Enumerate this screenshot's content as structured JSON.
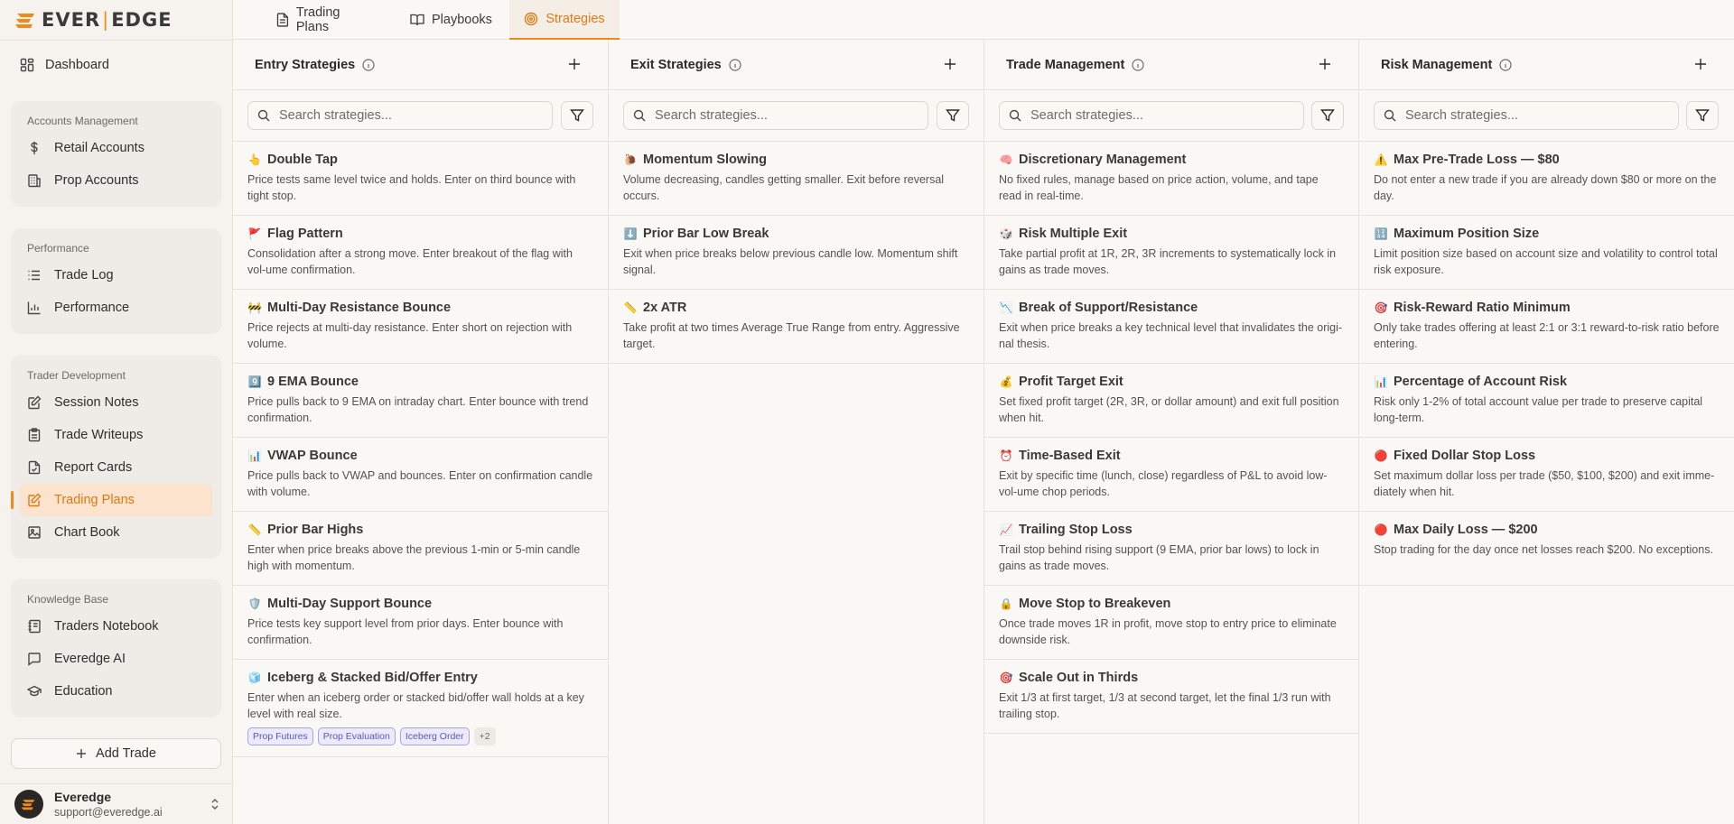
{
  "brand": {
    "left": "EVER",
    "sep": "|",
    "right": "EDGE",
    "accent": "#f28a1a"
  },
  "sidebar": {
    "dashboard": "Dashboard",
    "groups": [
      {
        "title": "Accounts Management",
        "items": [
          {
            "label": "Retail Accounts",
            "icon": "dollar-icon"
          },
          {
            "label": "Prop Accounts",
            "icon": "building-icon"
          }
        ]
      },
      {
        "title": "Performance",
        "items": [
          {
            "label": "Trade Log",
            "icon": "list-icon"
          },
          {
            "label": "Performance",
            "icon": "bar-chart-icon"
          }
        ]
      },
      {
        "title": "Trader Development",
        "items": [
          {
            "label": "Session Notes",
            "icon": "edit-note-icon"
          },
          {
            "label": "Trade Writeups",
            "icon": "clipboard-icon"
          },
          {
            "label": "Report Cards",
            "icon": "file-check-icon"
          },
          {
            "label": "Trading Plans",
            "icon": "pencil-square-icon",
            "active": true
          },
          {
            "label": "Chart Book",
            "icon": "image-icon"
          }
        ]
      },
      {
        "title": "Knowledge Base",
        "items": [
          {
            "label": "Traders Notebook",
            "icon": "notebook-icon"
          },
          {
            "label": "Everedge AI",
            "icon": "chat-icon"
          },
          {
            "label": "Education",
            "icon": "graduation-cap-icon"
          }
        ]
      }
    ],
    "add_trade": "Add Trade",
    "user": {
      "name": "Everedge",
      "email": "support@everedge.ai"
    }
  },
  "tabs": [
    {
      "label": "Trading Plans",
      "icon": "document-icon"
    },
    {
      "label": "Playbooks",
      "icon": "book-icon"
    },
    {
      "label": "Strategies",
      "icon": "target-icon",
      "active": true
    }
  ],
  "search_placeholder": "Search strategies...",
  "columns": [
    {
      "title": "Entry Strategies",
      "cards": [
        {
          "emoji": "👆",
          "title": "Double Tap",
          "desc": "Price tests same level twice and holds. Enter on third bounce with tight stop."
        },
        {
          "emoji": "🚩",
          "title": "Flag Pattern",
          "desc": "Consolidation after a strong move. Enter breakout of the flag with vol-ume confirmation."
        },
        {
          "emoji": "🚧",
          "title": "Multi-Day Resistance Bounce",
          "desc": "Price rejects at multi-day resistance. Enter short on rejection with volume."
        },
        {
          "emoji": "9️⃣",
          "title": "9 EMA Bounce",
          "desc": "Price pulls back to 9 EMA on intraday chart. Enter bounce with trend confirmation."
        },
        {
          "emoji": "📊",
          "title": "VWAP Bounce",
          "desc": "Price pulls back to VWAP and bounces. Enter on confirmation candle with volume."
        },
        {
          "emoji": "📏",
          "title": "Prior Bar Highs",
          "desc": "Enter when price breaks above the previous 1-min or 5-min candle high with momentum."
        },
        {
          "emoji": "🛡️",
          "title": "Multi-Day Support Bounce",
          "desc": "Price tests key support level from prior days. Enter bounce with confirmation."
        },
        {
          "emoji": "🧊",
          "title": "Iceberg & Stacked Bid/Offer Entry",
          "desc": "Enter when an iceberg order or stacked bid/offer wall holds at a key level with real size.",
          "tags": [
            "Prop Futures",
            "Prop Evaluation",
            "Iceberg Order"
          ],
          "more": "+2"
        }
      ]
    },
    {
      "title": "Exit Strategies",
      "cards": [
        {
          "emoji": "🐌",
          "title": "Momentum Slowing",
          "desc": "Volume decreasing, candles getting smaller. Exit before reversal occurs."
        },
        {
          "emoji": "⬇️",
          "title": "Prior Bar Low Break",
          "desc": "Exit when price breaks below previous candle low. Momentum shift signal."
        },
        {
          "emoji": "📏",
          "title": "2x ATR",
          "desc": "Take profit at two times Average True Range from entry. Aggressive target."
        }
      ]
    },
    {
      "title": "Trade Management",
      "cards": [
        {
          "emoji": "🧠",
          "title": "Discretionary Management",
          "desc": "No fixed rules, manage based on price action, volume, and tape read in real-time."
        },
        {
          "emoji": "🎲",
          "title": "Risk Multiple Exit",
          "desc": "Take partial profit at 1R, 2R, 3R increments to systematically lock in gains as trade moves."
        },
        {
          "emoji": "📉",
          "title": "Break of Support/Resistance",
          "desc": "Exit when price breaks a key technical level that invalidates the origi-nal thesis."
        },
        {
          "emoji": "💰",
          "title": "Profit Target Exit",
          "desc": "Set fixed profit target (2R, 3R, or dollar amount) and exit full position when hit."
        },
        {
          "emoji": "⏰",
          "title": "Time-Based Exit",
          "desc": "Exit by specific time (lunch, close) regardless of P&L to avoid low-vol-ume chop periods."
        },
        {
          "emoji": "📈",
          "title": "Trailing Stop Loss",
          "desc": "Trail stop behind rising support (9 EMA, prior bar lows) to lock in gains as trade moves."
        },
        {
          "emoji": "🔒",
          "title": "Move Stop to Breakeven",
          "desc": "Once trade moves 1R in profit, move stop to entry price to eliminate downside risk."
        },
        {
          "emoji": "🎯",
          "title": "Scale Out in Thirds",
          "desc": "Exit 1/3 at first target, 1/3 at second target, let the final 1/3 run with trailing stop."
        }
      ]
    },
    {
      "title": "Risk Management",
      "cards": [
        {
          "emoji": "⚠️",
          "title": "Max Pre-Trade Loss — $80",
          "desc": "Do not enter a new trade if you are already down $80 or more on the day."
        },
        {
          "emoji": "🔢",
          "title": "Maximum Position Size",
          "desc": "Limit position size based on account size and volatility to control total risk exposure."
        },
        {
          "emoji": "🎯",
          "title": "Risk-Reward Ratio Minimum",
          "desc": "Only take trades offering at least 2:1 or 3:1 reward-to-risk ratio before entering."
        },
        {
          "emoji": "📊",
          "title": "Percentage of Account Risk",
          "desc": "Risk only 1-2% of total account value per trade to preserve capital long-term."
        },
        {
          "emoji": "🔴",
          "title": "Fixed Dollar Stop Loss",
          "desc": "Set maximum dollar loss per trade ($50, $100, $200) and exit imme-diately when hit."
        },
        {
          "emoji": "🔴",
          "title": "Max Daily Loss — $200",
          "desc": "Stop trading for the day once net losses reach $200. No exceptions."
        }
      ]
    }
  ]
}
